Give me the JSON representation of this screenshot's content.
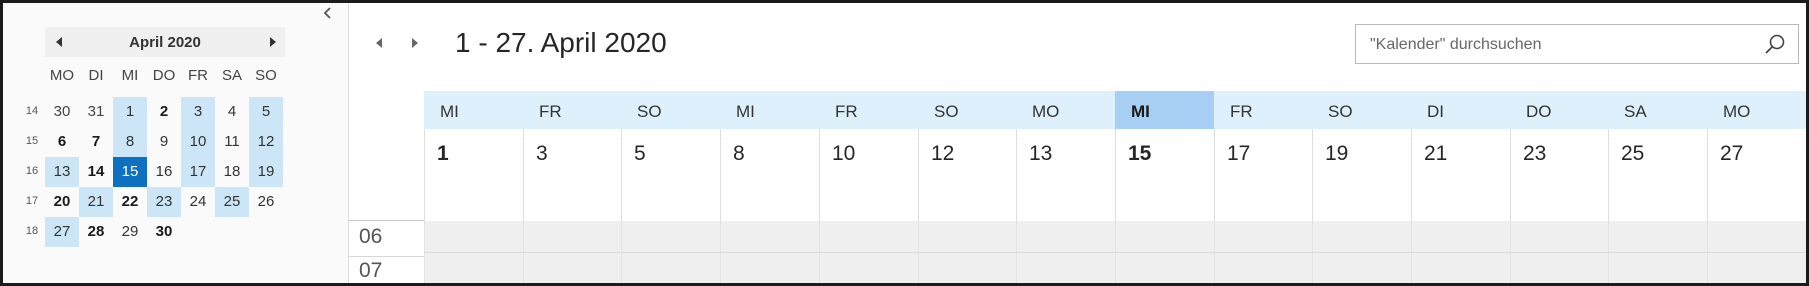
{
  "mini_calendar": {
    "title": "April 2020",
    "weekdays": [
      "MO",
      "DI",
      "MI",
      "DO",
      "FR",
      "SA",
      "SO"
    ],
    "weeks": [
      {
        "num": "14",
        "days": [
          {
            "d": "30",
            "state": "other"
          },
          {
            "d": "31",
            "state": "other"
          },
          {
            "d": "1",
            "state": "sel"
          },
          {
            "d": "2",
            "state": "bold"
          },
          {
            "d": "3",
            "state": "sel"
          },
          {
            "d": "4",
            "state": ""
          },
          {
            "d": "5",
            "state": "sel"
          }
        ]
      },
      {
        "num": "15",
        "days": [
          {
            "d": "6",
            "state": "bold"
          },
          {
            "d": "7",
            "state": "bold"
          },
          {
            "d": "8",
            "state": "sel"
          },
          {
            "d": "9",
            "state": ""
          },
          {
            "d": "10",
            "state": "sel"
          },
          {
            "d": "11",
            "state": ""
          },
          {
            "d": "12",
            "state": "sel"
          }
        ]
      },
      {
        "num": "16",
        "days": [
          {
            "d": "13",
            "state": "sel"
          },
          {
            "d": "14",
            "state": "bold"
          },
          {
            "d": "15",
            "state": "today"
          },
          {
            "d": "16",
            "state": ""
          },
          {
            "d": "17",
            "state": "sel"
          },
          {
            "d": "18",
            "state": ""
          },
          {
            "d": "19",
            "state": "sel"
          }
        ]
      },
      {
        "num": "17",
        "days": [
          {
            "d": "20",
            "state": "bold"
          },
          {
            "d": "21",
            "state": "sel"
          },
          {
            "d": "22",
            "state": "bold"
          },
          {
            "d": "23",
            "state": "sel"
          },
          {
            "d": "24",
            "state": ""
          },
          {
            "d": "25",
            "state": "sel"
          },
          {
            "d": "26",
            "state": ""
          }
        ]
      },
      {
        "num": "18",
        "days": [
          {
            "d": "27",
            "state": "sel"
          },
          {
            "d": "28",
            "state": "bold"
          },
          {
            "d": "29",
            "state": ""
          },
          {
            "d": "30",
            "state": "bold"
          },
          {
            "d": "",
            "state": "empty"
          },
          {
            "d": "",
            "state": "empty"
          },
          {
            "d": "",
            "state": "empty"
          }
        ]
      }
    ]
  },
  "header": {
    "range_title": "1 - 27. April 2020",
    "search_placeholder": "\"Kalender\" durchsuchen"
  },
  "columns": [
    {
      "dow": "MI",
      "day": "1",
      "bold": true,
      "today": false
    },
    {
      "dow": "FR",
      "day": "3",
      "bold": false,
      "today": false
    },
    {
      "dow": "SO",
      "day": "5",
      "bold": false,
      "today": false
    },
    {
      "dow": "MI",
      "day": "8",
      "bold": false,
      "today": false
    },
    {
      "dow": "FR",
      "day": "10",
      "bold": false,
      "today": false
    },
    {
      "dow": "SO",
      "day": "12",
      "bold": false,
      "today": false
    },
    {
      "dow": "MO",
      "day": "13",
      "bold": false,
      "today": false
    },
    {
      "dow": "MI",
      "day": "15",
      "bold": true,
      "today": true
    },
    {
      "dow": "FR",
      "day": "17",
      "bold": false,
      "today": false
    },
    {
      "dow": "SO",
      "day": "19",
      "bold": false,
      "today": false
    },
    {
      "dow": "DI",
      "day": "21",
      "bold": false,
      "today": false
    },
    {
      "dow": "DO",
      "day": "23",
      "bold": false,
      "today": false
    },
    {
      "dow": "SA",
      "day": "25",
      "bold": false,
      "today": false
    },
    {
      "dow": "MO",
      "day": "27",
      "bold": false,
      "today": false
    }
  ],
  "time_labels": [
    "06",
    "07"
  ],
  "colors": {
    "selected_day": "#cde6f7",
    "today": "#0e70c0",
    "column_header": "#def0fc",
    "column_header_today": "#a7cff3",
    "grid": "#efefef"
  },
  "icons": [
    "collapse-arrow-icon",
    "chevron-left-icon",
    "chevron-right-icon",
    "search-icon"
  ]
}
